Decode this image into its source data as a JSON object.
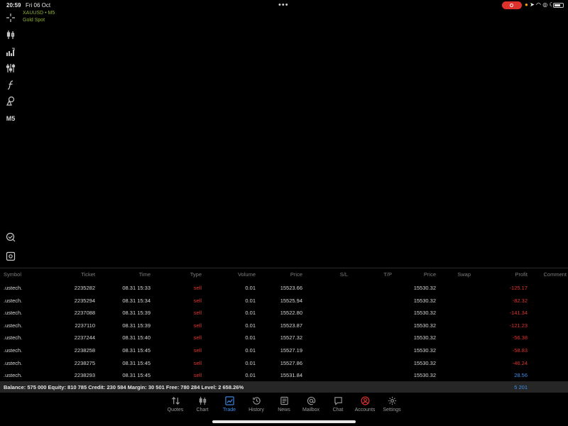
{
  "status": {
    "time": "20:59",
    "date": "Fri 06 Oct",
    "dots": "•••"
  },
  "chart": {
    "symbol": "XAUUSD • M5",
    "description": "Gold Spot",
    "timeframe": "M5"
  },
  "table": {
    "headers": {
      "symbol": "Symbol",
      "ticket": "Ticket",
      "time": "Time",
      "type": "Type",
      "volume": "Volume",
      "price": "Price",
      "sl": "S/L",
      "tp": "T/P",
      "current_price": "Price",
      "swap": "Swap",
      "profit": "Profit",
      "comment": "Comment"
    },
    "rows": [
      {
        "symbol": ".ustech.",
        "ticket": "2235282",
        "time": "08.31 15:33",
        "type": "sell",
        "volume": "0.01",
        "price": "15523.66",
        "current_price": "15530.32",
        "profit": "-125.17"
      },
      {
        "symbol": ".ustech.",
        "ticket": "2235294",
        "time": "08.31 15:34",
        "type": "sell",
        "volume": "0.01",
        "price": "15525.94",
        "current_price": "15530.32",
        "profit": "-82.32"
      },
      {
        "symbol": ".ustech.",
        "ticket": "2237088",
        "time": "08.31 15:39",
        "type": "sell",
        "volume": "0.01",
        "price": "15522.80",
        "current_price": "15530.32",
        "profit": "-141.34"
      },
      {
        "symbol": ".ustech.",
        "ticket": "2237110",
        "time": "08.31 15:39",
        "type": "sell",
        "volume": "0.01",
        "price": "15523.87",
        "current_price": "15530.32",
        "profit": "-121.23"
      },
      {
        "symbol": ".ustech.",
        "ticket": "2237244",
        "time": "08.31 15:40",
        "type": "sell",
        "volume": "0.01",
        "price": "15527.32",
        "current_price": "15530.32",
        "profit": "-56.38"
      },
      {
        "symbol": ".ustech.",
        "ticket": "2238258",
        "time": "08.31 15:45",
        "type": "sell",
        "volume": "0.01",
        "price": "15527.19",
        "current_price": "15530.32",
        "profit": "-58.83"
      },
      {
        "symbol": ".ustech.",
        "ticket": "2238275",
        "time": "08.31 15:45",
        "type": "sell",
        "volume": "0.01",
        "price": "15527.86",
        "current_price": "15530.32",
        "profit": "-46.24"
      },
      {
        "symbol": ".ustech.",
        "ticket": "2238293",
        "time": "08.31 15:45",
        "type": "sell",
        "volume": "0.01",
        "price": "15531.84",
        "current_price": "15530.32",
        "profit": "28.56"
      }
    ]
  },
  "balance": {
    "summary": "Balance: 575 000 Equity: 810 785 Credit: 230 584 Margin: 30 501 Free: 780 284 Level: 2 658.26%",
    "total_profit": "5 201"
  },
  "nav": [
    {
      "id": "quotes",
      "label": "Quotes",
      "icon": "arrows-updown-icon"
    },
    {
      "id": "chart",
      "label": "Chart",
      "icon": "candlestick-icon"
    },
    {
      "id": "trade",
      "label": "Trade",
      "icon": "trade-chart-icon"
    },
    {
      "id": "history",
      "label": "History",
      "icon": "history-icon"
    },
    {
      "id": "news",
      "label": "News",
      "icon": "news-icon"
    },
    {
      "id": "mailbox",
      "label": "Mailbox",
      "icon": "at-icon"
    },
    {
      "id": "chat",
      "label": "Chat",
      "icon": "chat-icon"
    },
    {
      "id": "accounts",
      "label": "Accounts",
      "icon": "account-icon"
    },
    {
      "id": "settings",
      "label": "Settings",
      "icon": "gear-icon"
    }
  ],
  "colors": {
    "accent": "#3c8ff0",
    "sell": "#e0342e",
    "symbol_green": "#8fae2f",
    "background": "#000000",
    "balance_bar": "#262626"
  }
}
